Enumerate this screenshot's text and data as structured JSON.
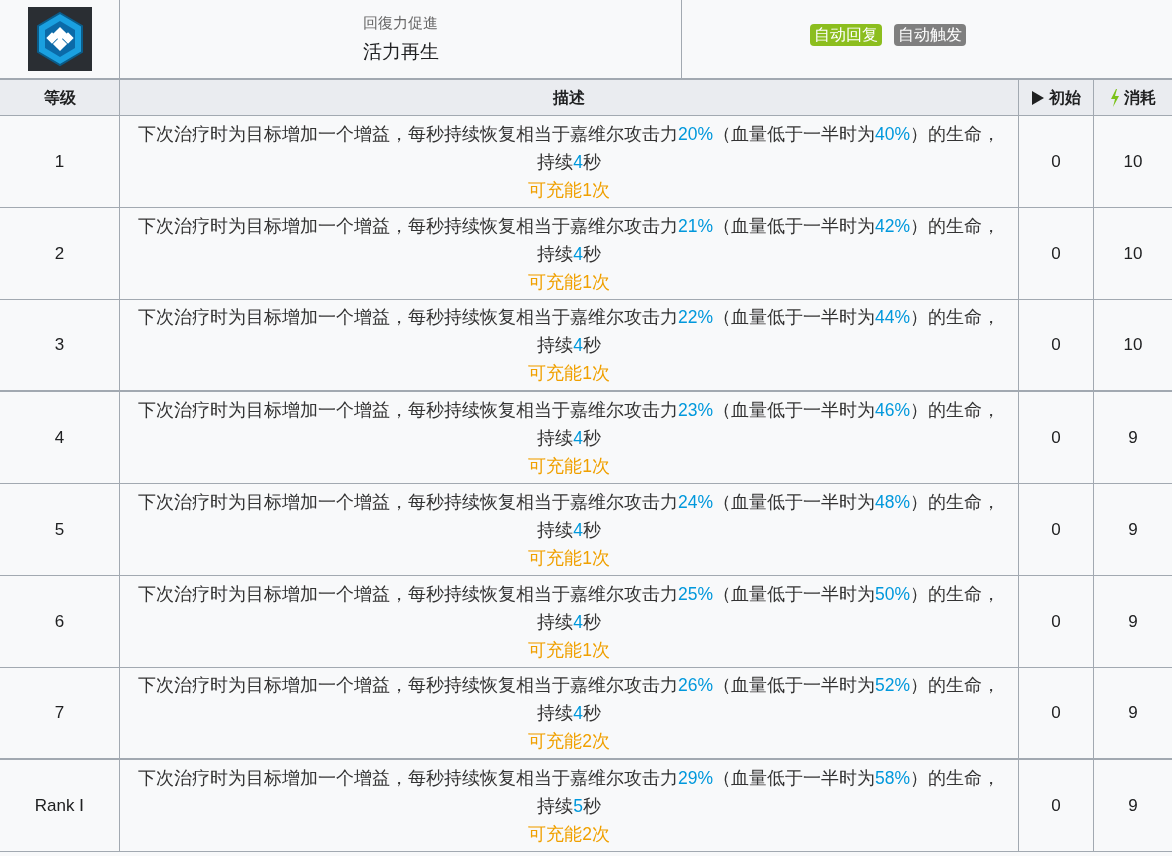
{
  "skill": {
    "category": "回復力促進",
    "name": "活力再生",
    "tags": [
      {
        "label": "自动回复",
        "color": "#8cbe1e"
      },
      {
        "label": "自动触发",
        "color": "#7f7f7f"
      }
    ]
  },
  "table": {
    "columns": [
      {
        "label": "等级"
      },
      {
        "label": "描述"
      },
      {
        "label": "初始",
        "kind": "play"
      },
      {
        "label": "消耗",
        "kind": "bolt"
      }
    ],
    "rows": [
      {
        "level": "1",
        "description": [
          {
            "kind": "plain",
            "text": "下次治疗时为目标增加一个增益，每秒持续恢复相当于嘉维尔攻击力"
          },
          {
            "kind": "value",
            "text": "20%"
          },
          {
            "kind": "plain",
            "text": "（血量低于一半时为"
          },
          {
            "kind": "value",
            "text": "40%"
          },
          {
            "kind": "plain",
            "text": "）的生命，持续"
          },
          {
            "kind": "value",
            "text": "4"
          },
          {
            "kind": "plain",
            "text": "秒"
          }
        ],
        "note": "可充能1次",
        "initial": "0",
        "cost": "10"
      },
      {
        "level": "2",
        "description": [
          {
            "kind": "plain",
            "text": "下次治疗时为目标增加一个增益，每秒持续恢复相当于嘉维尔攻击力"
          },
          {
            "kind": "value",
            "text": "21%"
          },
          {
            "kind": "plain",
            "text": "（血量低于一半时为"
          },
          {
            "kind": "value",
            "text": "42%"
          },
          {
            "kind": "plain",
            "text": "）的生命，持续"
          },
          {
            "kind": "value",
            "text": "4"
          },
          {
            "kind": "plain",
            "text": "秒"
          }
        ],
        "note": "可充能1次",
        "initial": "0",
        "cost": "10"
      },
      {
        "level": "3",
        "description": [
          {
            "kind": "plain",
            "text": "下次治疗时为目标增加一个增益，每秒持续恢复相当于嘉维尔攻击力"
          },
          {
            "kind": "value",
            "text": "22%"
          },
          {
            "kind": "plain",
            "text": "（血量低于一半时为"
          },
          {
            "kind": "value",
            "text": "44%"
          },
          {
            "kind": "plain",
            "text": "）的生命，持续"
          },
          {
            "kind": "value",
            "text": "4"
          },
          {
            "kind": "plain",
            "text": "秒"
          }
        ],
        "note": "可充能1次",
        "initial": "0",
        "cost": "10"
      },
      {
        "level": "4",
        "description": [
          {
            "kind": "plain",
            "text": "下次治疗时为目标增加一个增益，每秒持续恢复相当于嘉维尔攻击力"
          },
          {
            "kind": "value",
            "text": "23%"
          },
          {
            "kind": "plain",
            "text": "（血量低于一半时为"
          },
          {
            "kind": "value",
            "text": "46%"
          },
          {
            "kind": "plain",
            "text": "）的生命，持续"
          },
          {
            "kind": "value",
            "text": "4"
          },
          {
            "kind": "plain",
            "text": "秒"
          }
        ],
        "note": "可充能1次",
        "initial": "0",
        "cost": "9"
      },
      {
        "level": "5",
        "description": [
          {
            "kind": "plain",
            "text": "下次治疗时为目标增加一个增益，每秒持续恢复相当于嘉维尔攻击力"
          },
          {
            "kind": "value",
            "text": "24%"
          },
          {
            "kind": "plain",
            "text": "（血量低于一半时为"
          },
          {
            "kind": "value",
            "text": "48%"
          },
          {
            "kind": "plain",
            "text": "）的生命，持续"
          },
          {
            "kind": "value",
            "text": "4"
          },
          {
            "kind": "plain",
            "text": "秒"
          }
        ],
        "note": "可充能1次",
        "initial": "0",
        "cost": "9"
      },
      {
        "level": "6",
        "description": [
          {
            "kind": "plain",
            "text": "下次治疗时为目标增加一个增益，每秒持续恢复相当于嘉维尔攻击力"
          },
          {
            "kind": "value",
            "text": "25%"
          },
          {
            "kind": "plain",
            "text": "（血量低于一半时为"
          },
          {
            "kind": "value",
            "text": "50%"
          },
          {
            "kind": "plain",
            "text": "）的生命，持续"
          },
          {
            "kind": "value",
            "text": "4"
          },
          {
            "kind": "plain",
            "text": "秒"
          }
        ],
        "note": "可充能1次",
        "initial": "0",
        "cost": "9"
      },
      {
        "level": "7",
        "description": [
          {
            "kind": "plain",
            "text": "下次治疗时为目标增加一个增益，每秒持续恢复相当于嘉维尔攻击力"
          },
          {
            "kind": "value",
            "text": "26%"
          },
          {
            "kind": "plain",
            "text": "（血量低于一半时为"
          },
          {
            "kind": "value",
            "text": "52%"
          },
          {
            "kind": "plain",
            "text": "）的生命，持续"
          },
          {
            "kind": "value",
            "text": "4"
          },
          {
            "kind": "plain",
            "text": "秒"
          }
        ],
        "note": "可充能2次",
        "initial": "0",
        "cost": "9"
      },
      {
        "level": "Rank Ⅰ",
        "description": [
          {
            "kind": "plain",
            "text": "下次治疗时为目标增加一个增益，每秒持续恢复相当于嘉维尔攻击力"
          },
          {
            "kind": "value",
            "text": "29%"
          },
          {
            "kind": "plain",
            "text": "（血量低于一半时为"
          },
          {
            "kind": "value",
            "text": "58%"
          },
          {
            "kind": "plain",
            "text": "）的生命，持续"
          },
          {
            "kind": "value",
            "text": "5"
          },
          {
            "kind": "plain",
            "text": "秒"
          }
        ],
        "note": "可充能2次",
        "initial": "0",
        "cost": "9"
      }
    ]
  }
}
